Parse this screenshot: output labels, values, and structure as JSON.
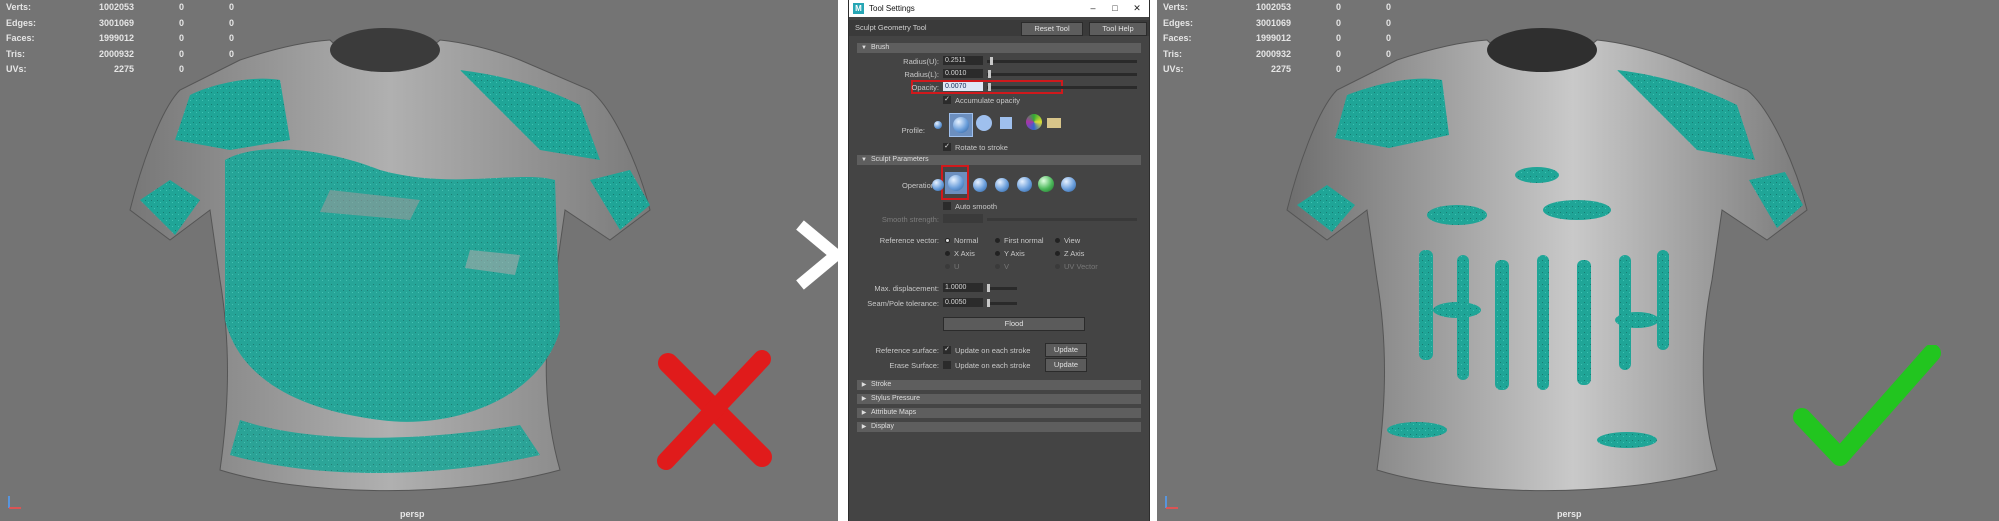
{
  "left_viewport": {
    "hud": [
      {
        "label": "Verts:",
        "value": "1002053",
        "a": "0",
        "b": "0"
      },
      {
        "label": "Edges:",
        "value": "3001069",
        "a": "0",
        "b": "0"
      },
      {
        "label": "Faces:",
        "value": "1999012",
        "a": "0",
        "b": "0"
      },
      {
        "label": "Tris:",
        "value": "2000932",
        "a": "0",
        "b": "0"
      },
      {
        "label": "UVs:",
        "value": "2275",
        "a": "0",
        "b": "0"
      }
    ],
    "camera": "persp",
    "verdict_icon": "red-cross-icon"
  },
  "right_viewport": {
    "hud": [
      {
        "label": "Verts:",
        "value": "1002053",
        "a": "0",
        "b": "0"
      },
      {
        "label": "Edges:",
        "value": "3001069",
        "a": "0",
        "b": "0"
      },
      {
        "label": "Faces:",
        "value": "1999012",
        "a": "0",
        "b": "0"
      },
      {
        "label": "Tris:",
        "value": "2000932",
        "a": "0",
        "b": "0"
      },
      {
        "label": "UVs:",
        "value": "2275",
        "a": "0",
        "b": "0"
      }
    ],
    "camera": "persp",
    "verdict_icon": "green-checkmark-icon"
  },
  "colors": {
    "viewport_bg": "#747474",
    "mesh_gray": "#9a9a9a",
    "paint_teal": "#1fa597",
    "cross_red": "#e01b1b",
    "check_green": "#22c51f",
    "highlight_red": "#d0191c",
    "panel_bg": "#444444"
  },
  "tool_settings": {
    "window_title": "Tool Settings",
    "tool_name": "Sculpt Geometry Tool",
    "reset_tool": "Reset Tool",
    "tool_help": "Tool Help",
    "brush": {
      "section": "Brush",
      "radius_u_label": "Radius(U):",
      "radius_u": "0.2511",
      "radius_u_level": 0.02,
      "radius_l_label": "Radius(L):",
      "radius_l": "0.0010",
      "radius_l_level": 0.01,
      "opacity_label": "Opacity:",
      "opacity": "0.0070",
      "opacity_level": 0.01,
      "accumulate_label": "Accumulate opacity",
      "profile_label": "Profile:",
      "rotate_label": "Rotate to stroke"
    },
    "sculpt": {
      "section": "Sculpt Parameters",
      "operation_label": "Operation:",
      "auto_smooth_label": "Auto smooth",
      "smooth_strength_label": "Smooth strength:",
      "reference_vector_label": "Reference vector:",
      "ref_options": [
        "Normal",
        "First normal",
        "View",
        "X Axis",
        "Y Axis",
        "Z Axis",
        "U",
        "V",
        "UV Vector"
      ],
      "max_disp_label": "Max. displacement:",
      "max_disp": "1.0000",
      "seam_label": "Seam/Pole tolerance:",
      "seam": "0.0050",
      "flood": "Flood",
      "ref_surface_label": "Reference surface:",
      "ref_surface_check": "Update on each stroke",
      "update1": "Update",
      "erase_surface_label": "Erase Surface:",
      "erase_surface_check": "Update on each stroke",
      "update2": "Update"
    },
    "collapsed_sections": [
      "Stroke",
      "Stylus Pressure",
      "Attribute Maps",
      "Display"
    ]
  }
}
